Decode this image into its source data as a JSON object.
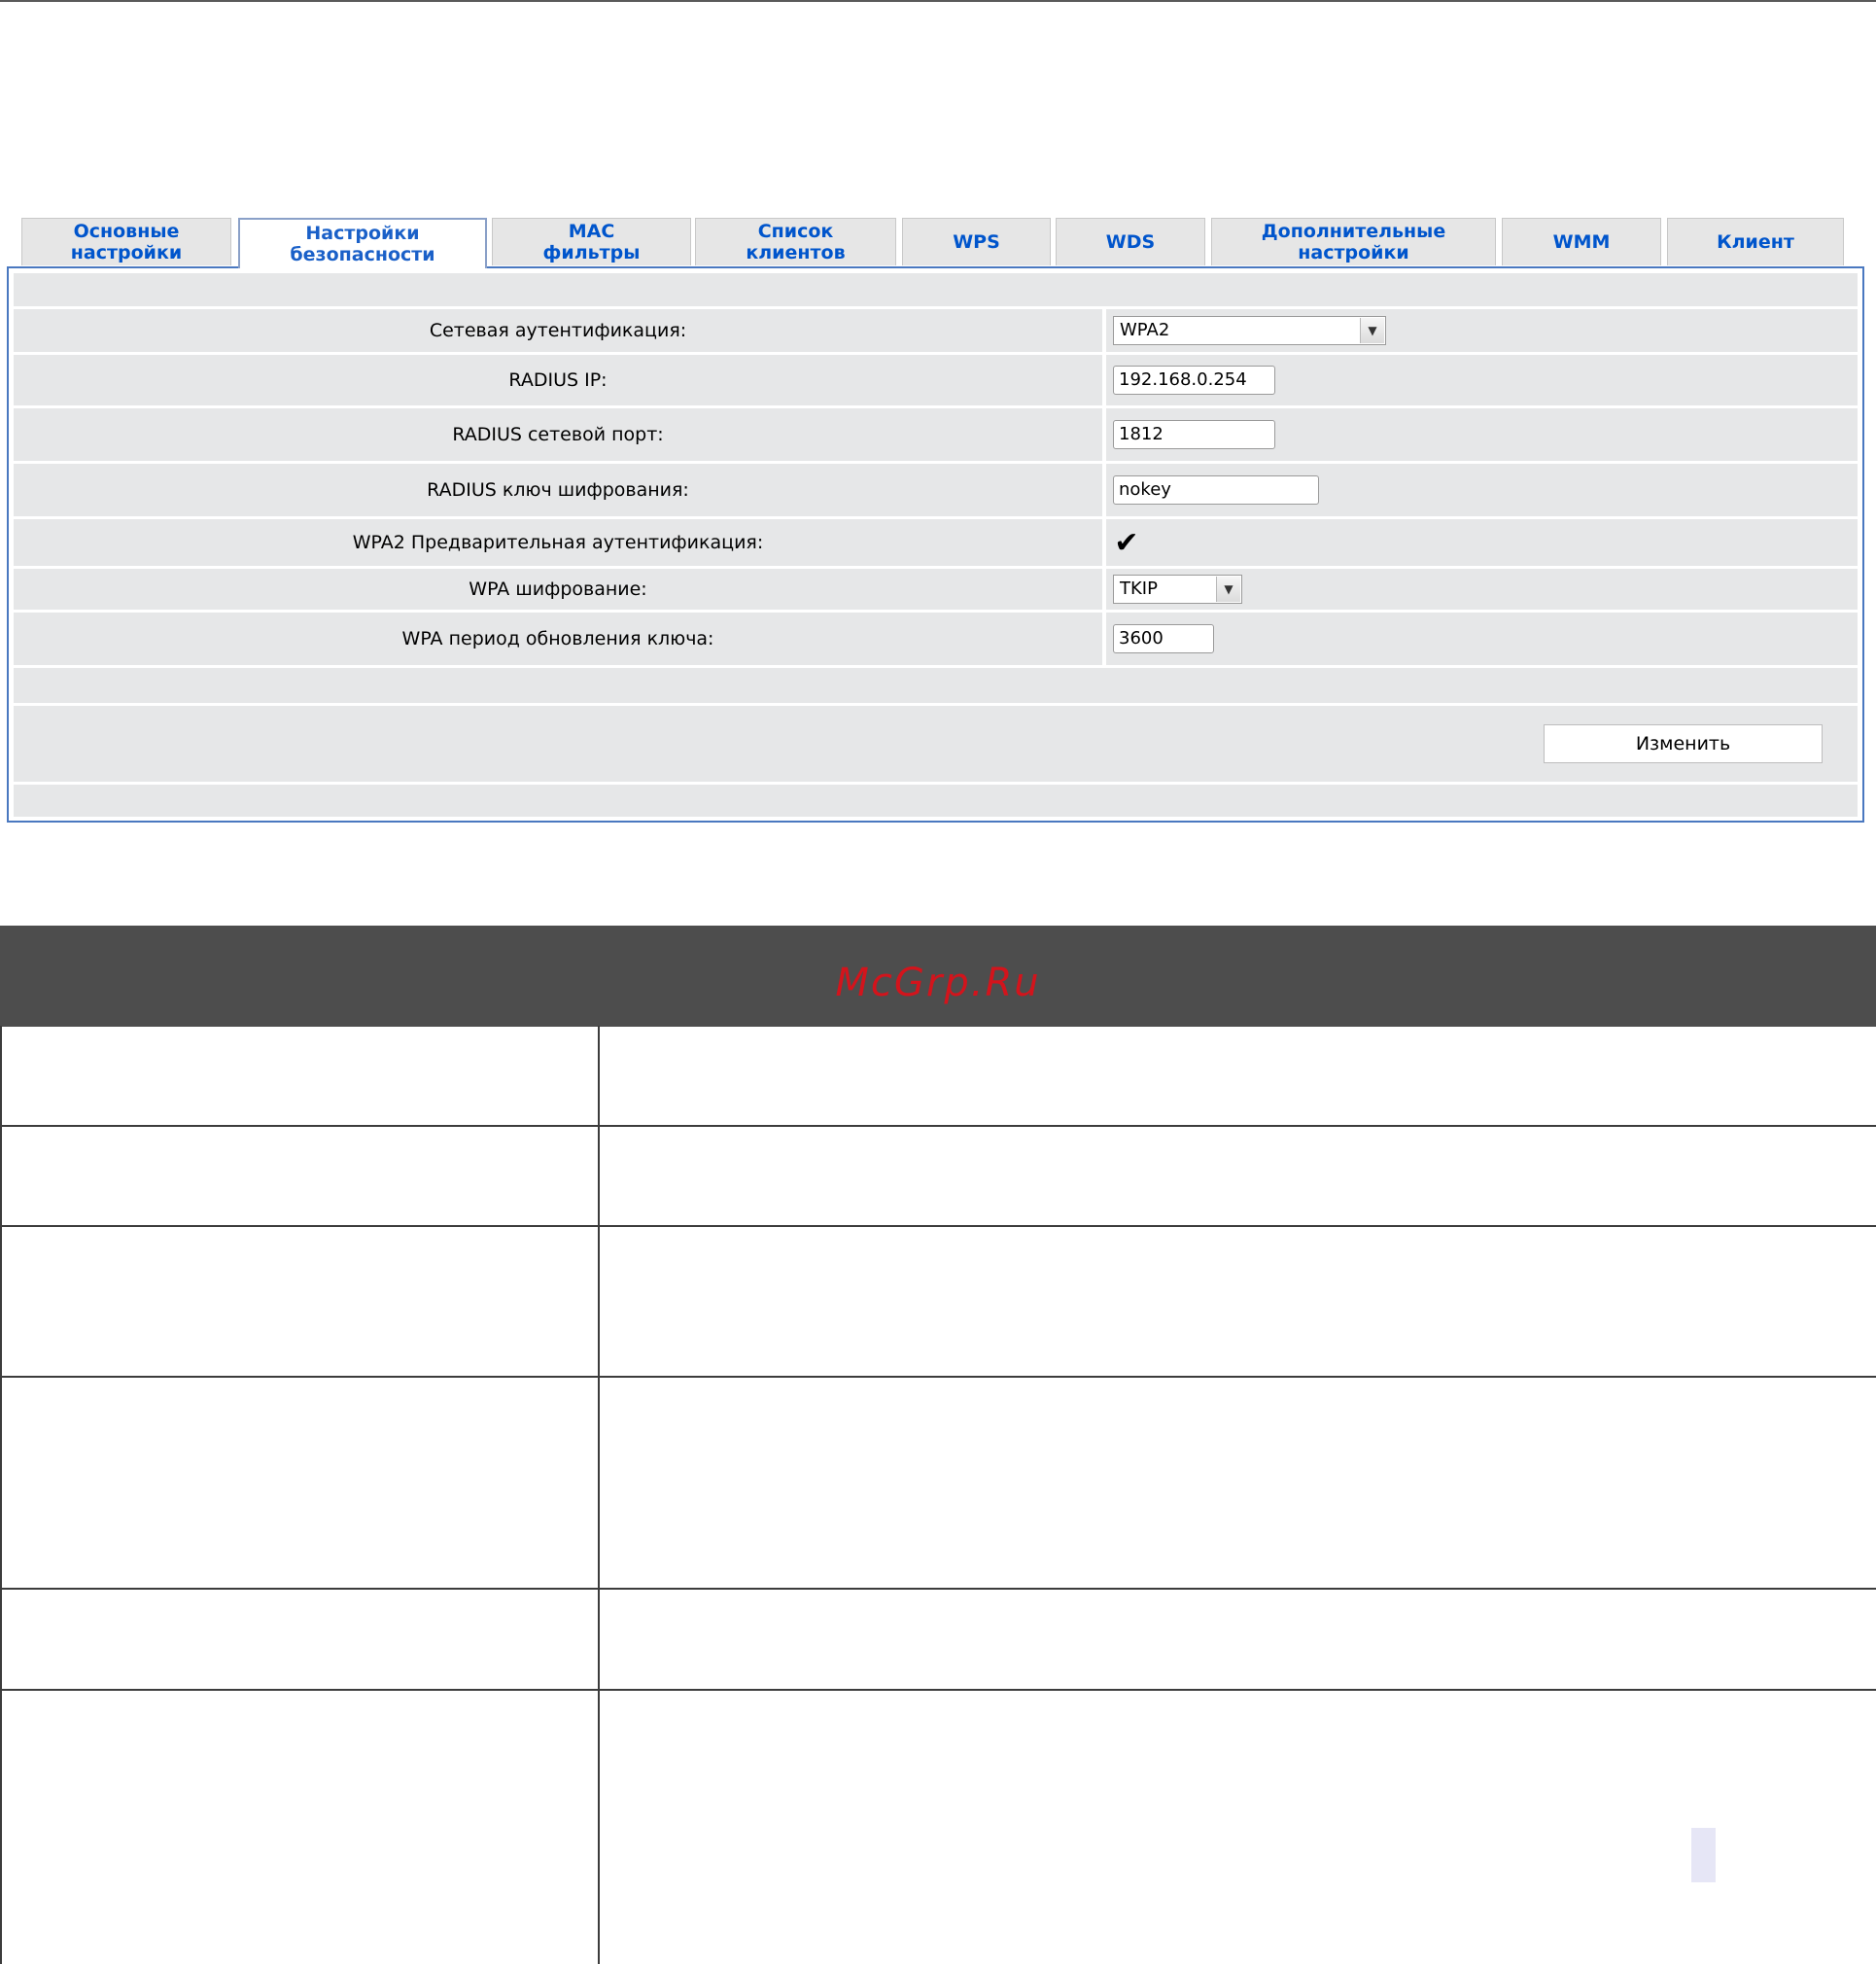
{
  "tabs": [
    {
      "label": "Основные\nнастройки",
      "active": false
    },
    {
      "label": "Настройки\nбезопасности",
      "active": true
    },
    {
      "label": "MAC\nфильтры",
      "active": false
    },
    {
      "label": "Список\nклиентов",
      "active": false
    },
    {
      "label": "WPS",
      "active": false
    },
    {
      "label": "WDS",
      "active": false
    },
    {
      "label": "Дополнительные\nнастройки",
      "active": false
    },
    {
      "label": "WMM",
      "active": false
    },
    {
      "label": "Клиент",
      "active": false
    }
  ],
  "form": {
    "auth_label": "Сетевая аутентификация:",
    "auth_value": "WPA2",
    "radius_ip_label": "RADIUS IP:",
    "radius_ip_value": "192.168.0.254",
    "radius_port_label": "RADIUS сетевой порт:",
    "radius_port_value": "1812",
    "radius_key_label": "RADIUS ключ шифрования:",
    "radius_key_value": "nokey",
    "preauth_label": "WPA2 Предварительная аутентификация:",
    "preauth_checked": true,
    "encryption_label": "WPA шифрование:",
    "encryption_value": "TKIP",
    "rekey_label": "WPA период обновления ключа:",
    "rekey_value": "3600"
  },
  "actions": {
    "change_label": "Изменить"
  },
  "watermark": {
    "text": "McGrp.Ru",
    "color": "#d3141c"
  },
  "colors": {
    "tab_text": "#0055cc",
    "panel_border": "#4a78c0",
    "row_bg": "#e6e7e8",
    "dark_bar": "#4d4d4d"
  }
}
